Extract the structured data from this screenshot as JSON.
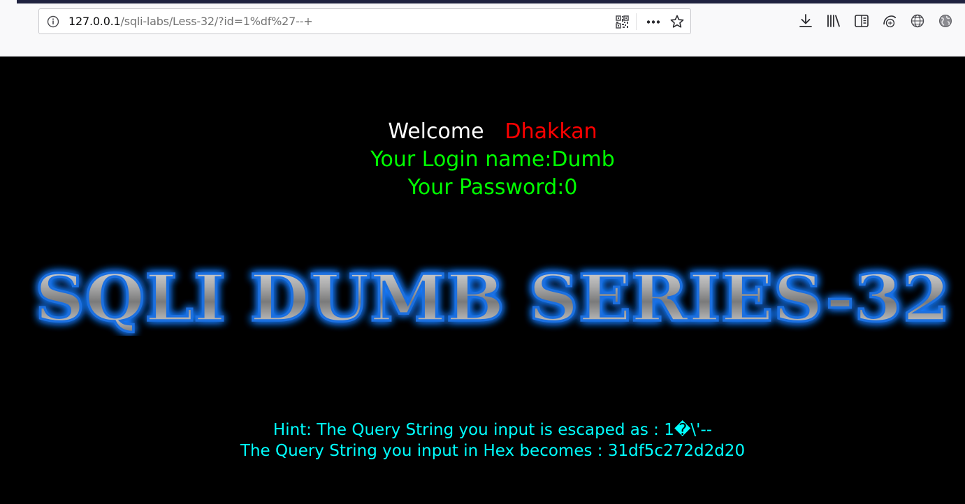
{
  "browser": {
    "url_host": "127.0.0.1",
    "url_path": "/sqli-labs/Less-32/?id=1%df%27--+",
    "icons": [
      "info-icon",
      "qr-code-icon",
      "more-icon",
      "star-icon",
      "download-icon",
      "library-icon",
      "reader-view-icon",
      "extension-icon",
      "globe-icon",
      "globe-alt-icon"
    ]
  },
  "page": {
    "welcome": "Welcome",
    "user_name": "Dhakkan",
    "login_line": "Your Login name:Dumb",
    "password_line": "Your Password:0",
    "banner_title": "SQLI DUMB SERIES-32",
    "hint_line1": "Hint: The Query String you input is escaped as : 1�\\'--",
    "hint_line2": "The Query String you input in Hex becomes : 31df5c272d2d20"
  },
  "colors": {
    "background": "#000000",
    "welcome": "#ffffff",
    "user_name": "#ff0000",
    "login": "#00ff00",
    "hint": "#00ffff",
    "banner_glow": "#1a7cff"
  }
}
